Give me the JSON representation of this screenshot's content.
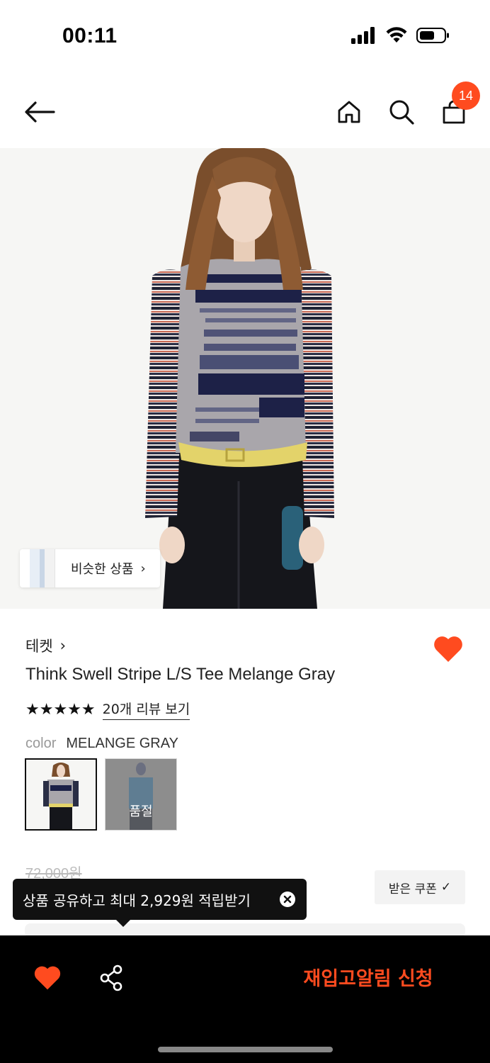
{
  "status_bar": {
    "time": "00:11"
  },
  "header": {
    "cart_count": "14"
  },
  "hero": {
    "similar_label": "비슷한 상품",
    "similar_chevron": "›"
  },
  "product": {
    "brand": "테켓",
    "brand_chevron": "›",
    "title": "Think Swell Stripe L/S Tee Melange Gray",
    "rating": 5,
    "stars": "★★★★★",
    "review_link": "20개 리뷰 보기",
    "color_key": "color",
    "color_value": "MELANGE GRAY",
    "swatches": [
      {
        "name": "MELANGE GRAY",
        "selected": true
      },
      {
        "name": "BLUE",
        "status": "품절"
      }
    ],
    "original_price": "72,000원",
    "coupon_label": "받은 쿠폰",
    "coupon_check": "✓",
    "liked": true
  },
  "tooltip": {
    "text": "상품 공유하고 최대 2,929원 적립받기"
  },
  "bottom_bar": {
    "restock_label": "재입고알림 신청"
  },
  "colors": {
    "accent": "#ff4b1f",
    "bottom_bar_bg": "#000000",
    "text": "#222222"
  }
}
